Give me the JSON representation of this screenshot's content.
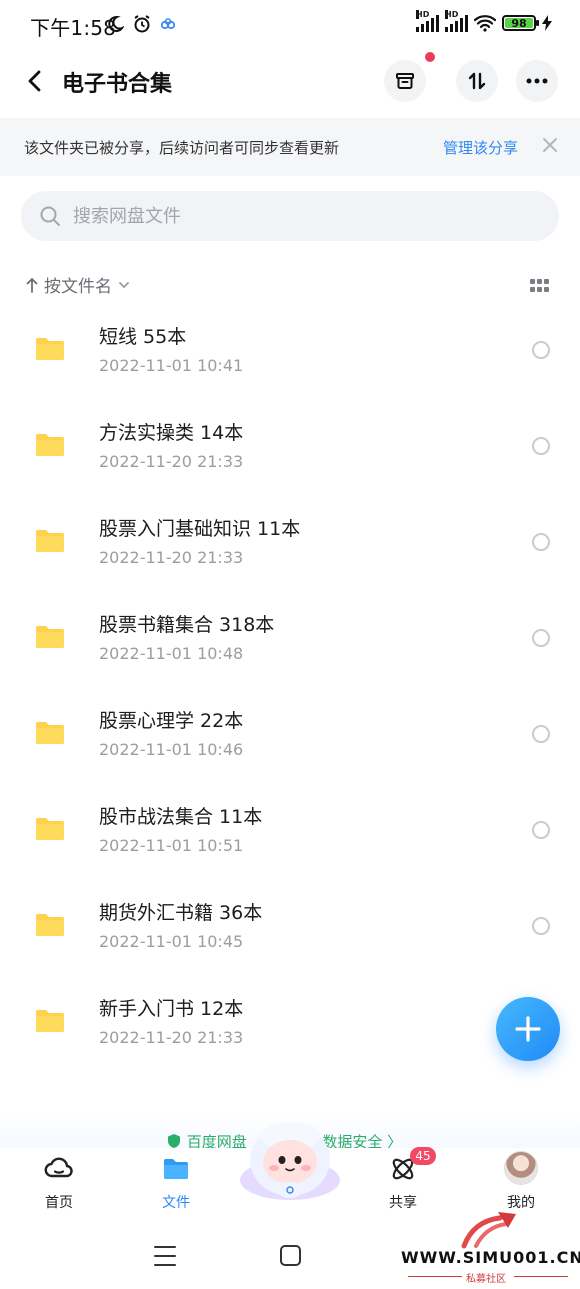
{
  "status_bar": {
    "time": "下午1:58",
    "signal_label_1": "HD",
    "signal_label_2": "HD",
    "battery": "98",
    "icons": [
      "moon-icon",
      "alarm-icon",
      "cloud-app-icon",
      "signal-icon",
      "signal-icon",
      "wifi-icon",
      "battery-icon",
      "charging-icon"
    ]
  },
  "header": {
    "title": "电子书合集",
    "icons": [
      "back-chevron-icon",
      "archive-box-icon",
      "sort-arrows-icon",
      "more-dots-icon"
    ],
    "notification_dot": true
  },
  "share_notice": {
    "text": "该文件夹已被分享，后续访问者可同步查看更新",
    "link": "管理该分享"
  },
  "search": {
    "placeholder": "搜索网盘文件"
  },
  "sort": {
    "label": "按文件名",
    "view_mode": "grid"
  },
  "files": [
    {
      "name": "短线 55本",
      "date": "2022-11-01  10:41"
    },
    {
      "name": "方法实操类 14本",
      "date": "2022-11-20  21:33"
    },
    {
      "name": "股票入门基础知识 11本",
      "date": "2022-11-20  21:33"
    },
    {
      "name": "股票书籍集合 318本",
      "date": "2022-11-01  10:48"
    },
    {
      "name": "股票心理学 22本",
      "date": "2022-11-01  10:46"
    },
    {
      "name": "股市战法集合 11本",
      "date": "2022-11-01  10:51"
    },
    {
      "name": "期货外汇书籍 36本",
      "date": "2022-11-01  10:45"
    },
    {
      "name": "新手入门书 12本",
      "date": "2022-11-20  21:33"
    }
  ],
  "promo": {
    "left": "百度网盘",
    "right": "数据安全 〉"
  },
  "tabs": {
    "home": "首页",
    "files": "文件",
    "share": "共享",
    "share_badge": "45",
    "mine": "我的"
  },
  "watermark": {
    "text": "WWW.SIMU001.CN",
    "sub": "私募社区"
  },
  "colors": {
    "accent": "#2f87f5",
    "folder": "#fdd34d",
    "badge": "#f24a64",
    "notice_bg": "#f5f6f8"
  }
}
